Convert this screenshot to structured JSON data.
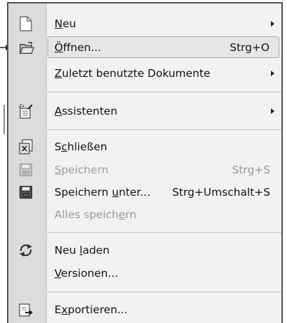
{
  "menu": {
    "items": [
      {
        "id": "neu",
        "label": "Neu",
        "accel": 0,
        "icon": "new-document-icon",
        "submenu": true
      },
      {
        "id": "oeffnen",
        "label": "Öffnen...",
        "accel": 0,
        "shortcut": "Strg+O",
        "icon": "open-folder-icon",
        "highlighted": true
      },
      {
        "id": "zuletzt",
        "label": "Zuletzt benutzte Dokumente",
        "accel": 0,
        "submenu": true
      },
      {
        "id": "assistenten",
        "label": "Assistenten",
        "accel": 0,
        "icon": "wizard-icon",
        "submenu": true
      },
      {
        "id": "schliessen",
        "label": "Schließen",
        "accel": 1,
        "icon": "close-document-icon"
      },
      {
        "id": "speichern",
        "label": "Speichern",
        "accel": 0,
        "shortcut": "Strg+S",
        "icon": "save-disk-icon",
        "disabled": true
      },
      {
        "id": "speichern-unter",
        "label": "Speichern unter...",
        "accel": 10,
        "shortcut": "Strg+Umschalt+S",
        "icon": "save-as-icon"
      },
      {
        "id": "alles-speichern",
        "label": "Alles speichern",
        "accel": 12,
        "disabled": true
      },
      {
        "id": "neu-laden",
        "label": "Neu laden",
        "accel": 4,
        "icon": "reload-icon"
      },
      {
        "id": "versionen",
        "label": "Versionen...",
        "accel": 0
      },
      {
        "id": "exportieren",
        "label": "Exportieren...",
        "accel": 1,
        "icon": "export-icon"
      }
    ]
  }
}
